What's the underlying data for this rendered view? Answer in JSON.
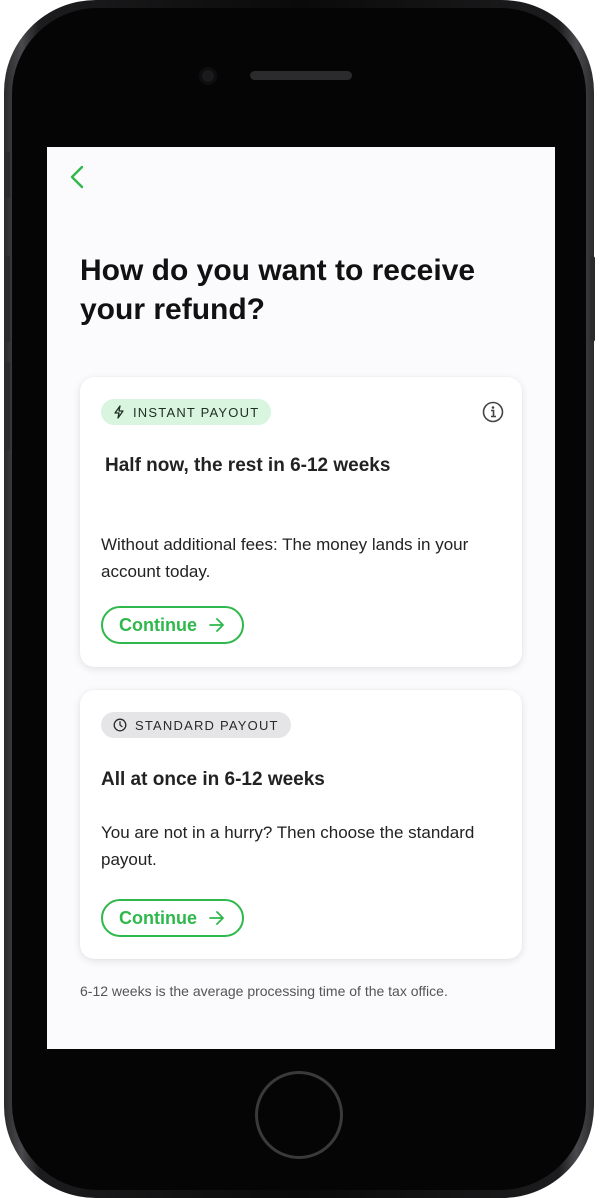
{
  "screen": {
    "title": "How do you want to receive your refund?",
    "accent_color": "#2fb84b"
  },
  "options": [
    {
      "badge_label": "INSTANT PAYOUT",
      "badge_icon": "lightning-icon",
      "heading": "Half now, the rest in 6-12 weeks",
      "description": "Without additional fees: The money lands in your account today.",
      "button_label": "Continue",
      "has_info_icon": true
    },
    {
      "badge_label": "STANDARD PAYOUT",
      "badge_icon": "clock-icon",
      "heading": "All at once in 6-12 weeks",
      "description": "You are not in a hurry? Then choose the standard payout.",
      "button_label": "Continue"
    }
  ],
  "footnote": "6-12 weeks is the average processing time of the tax office."
}
